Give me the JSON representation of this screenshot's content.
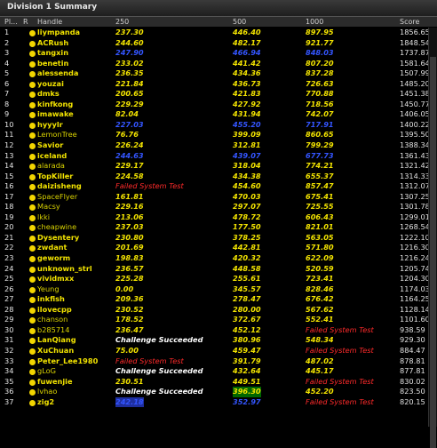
{
  "window": {
    "title": "Division 1 Summary"
  },
  "columns": [
    "Pl...",
    "R",
    "Handle",
    "250",
    "500",
    "1000",
    "Score"
  ],
  "rows": [
    {
      "rank": "1",
      "handle": "liympanda",
      "s250": "237.30",
      "s500": "446.40",
      "s1000": "897.95",
      "score": "1856.65"
    },
    {
      "rank": "2",
      "handle": "ACRush",
      "s250": "244.60",
      "s500": "482.17",
      "s1000": "921.77",
      "score": "1848.54"
    },
    {
      "rank": "3",
      "handle": "tangxin",
      "s250": "247.90",
      "s500": "466.94",
      "s1000": "848.03",
      "score": "1737.87"
    },
    {
      "rank": "4",
      "handle": "benetin",
      "s250": "233.02",
      "s500": "441.42",
      "s1000": "807.20",
      "score": "1581.64"
    },
    {
      "rank": "5",
      "handle": "alessenda",
      "s250": "236.35",
      "s500": "434.36",
      "s1000": "837.28",
      "score": "1507.99"
    },
    {
      "rank": "6",
      "handle": "youzai",
      "s250": "221.84",
      "s500": "436.73",
      "s1000": "726.63",
      "score": "1485.20"
    },
    {
      "rank": "7",
      "handle": "dmks",
      "s250": "200.65",
      "s500": "421.83",
      "s1000": "770.88",
      "score": "1451.38"
    },
    {
      "rank": "8",
      "handle": "kinfkong",
      "s250": "229.29",
      "s500": "427.92",
      "s1000": "718.56",
      "score": "1450.77"
    },
    {
      "rank": "9",
      "handle": "imawake",
      "s250": "82.04",
      "s500": "431.94",
      "s1000": "742.07",
      "score": "1406.05"
    },
    {
      "rank": "10",
      "handle": "hyyylr",
      "s250": "227.03",
      "s500": "455.20",
      "s1000": "717.91",
      "score": "1400.22"
    },
    {
      "rank": "11",
      "handle": "LemonTree",
      "s250": "76.76",
      "s500": "399.09",
      "s1000": "860.65",
      "score": "1395.50"
    },
    {
      "rank": "12",
      "handle": "Savior",
      "s250": "226.24",
      "s500": "312.81",
      "s1000": "799.29",
      "score": "1388.34"
    },
    {
      "rank": "13",
      "handle": "iceland",
      "s250": "244.63",
      "s500": "439.07",
      "s1000": "677.73",
      "score": "1361.43"
    },
    {
      "rank": "14",
      "handle": "alarada",
      "s250": "229.17",
      "s500": "318.04",
      "s1000": "774.21",
      "score": "1321.42"
    },
    {
      "rank": "15",
      "handle": "TopKiller",
      "s250": "224.58",
      "s500": "434.38",
      "s1000": "655.37",
      "score": "1314.33"
    },
    {
      "rank": "16",
      "handle": "daizisheng",
      "s250": "Failed System Test",
      "s500": "454.60",
      "s1000": "857.47",
      "score": "1312.07"
    },
    {
      "rank": "17",
      "handle": "SpaceFlyer",
      "s250": "161.81",
      "s500": "470.03",
      "s1000": "675.41",
      "score": "1307.25"
    },
    {
      "rank": "18",
      "handle": "Macsy",
      "s250": "229.16",
      "s500": "297.07",
      "s1000": "725.55",
      "score": "1301.78"
    },
    {
      "rank": "19",
      "handle": "lkki",
      "s250": "213.06",
      "s500": "478.72",
      "s1000": "606.43",
      "score": "1299.01"
    },
    {
      "rank": "20",
      "handle": "cheapwine",
      "s250": "237.03",
      "s500": "177.50",
      "s1000": "821.01",
      "score": "1268.54"
    },
    {
      "rank": "21",
      "handle": "Dysentery",
      "s250": "230.80",
      "s500": "378.25",
      "s1000": "563.05",
      "score": "1222.10"
    },
    {
      "rank": "22",
      "handle": "zwdant",
      "s250": "201.69",
      "s500": "442.81",
      "s1000": "571.80",
      "score": "1216.30"
    },
    {
      "rank": "23",
      "handle": "geworm",
      "s250": "198.83",
      "s500": "420.32",
      "s1000": "622.09",
      "score": "1216.24"
    },
    {
      "rank": "24",
      "handle": "unknown_strl",
      "s250": "236.57",
      "s500": "448.58",
      "s1000": "520.59",
      "score": "1205.74"
    },
    {
      "rank": "25",
      "handle": "vividmxx",
      "s250": "225.28",
      "s500": "255.61",
      "s1000": "723.41",
      "score": "1204.30"
    },
    {
      "rank": "26",
      "handle": "Yeung",
      "s250": "0.00",
      "s500": "345.57",
      "s1000": "828.46",
      "score": "1174.03"
    },
    {
      "rank": "27",
      "handle": "inkfish",
      "s250": "209.36",
      "s500": "278.47",
      "s1000": "676.42",
      "score": "1164.25"
    },
    {
      "rank": "28",
      "handle": "ilovecpp",
      "s250": "230.52",
      "s500": "280.00",
      "s1000": "567.62",
      "score": "1128.14"
    },
    {
      "rank": "29",
      "handle": "chanson",
      "s250": "178.52",
      "s500": "372.67",
      "s1000": "552.41",
      "score": "1101.60"
    },
    {
      "rank": "30",
      "handle": "b285714",
      "s250": "236.47",
      "s500": "452.12",
      "s1000": "Failed System Test",
      "score": "938.59"
    },
    {
      "rank": "31",
      "handle": "LanQiang",
      "s250": "Challenge Succeeded",
      "s500": "380.96",
      "s1000": "548.34",
      "score": "929.30"
    },
    {
      "rank": "32",
      "handle": "XuChuan",
      "s250": "75.00",
      "s500": "459.47",
      "s1000": "Failed System Test",
      "score": "884.47"
    },
    {
      "rank": "33",
      "handle": "Peter_Lee1980",
      "s250": "Failed System Test",
      "s500": "391.79",
      "s1000": "487.02",
      "score": "878.81"
    },
    {
      "rank": "34",
      "handle": "gLoG",
      "s250": "Challenge Succeeded",
      "s500": "432.64",
      "s1000": "445.17",
      "score": "877.81"
    },
    {
      "rank": "35",
      "handle": "fuwenjie",
      "s250": "230.51",
      "s500": "449.51",
      "s1000": "Failed System Test",
      "score": "830.02"
    },
    {
      "rank": "36",
      "handle": "lvhao",
      "s250": "Challenge Succeeded",
      "s500": "396.30",
      "s1000": "452.20",
      "score": "823.50"
    },
    {
      "rank": "37",
      "handle": "zig2",
      "s250": "242.18",
      "s500": "352.97",
      "s1000": "Failed System Test",
      "score": "820.15"
    }
  ]
}
